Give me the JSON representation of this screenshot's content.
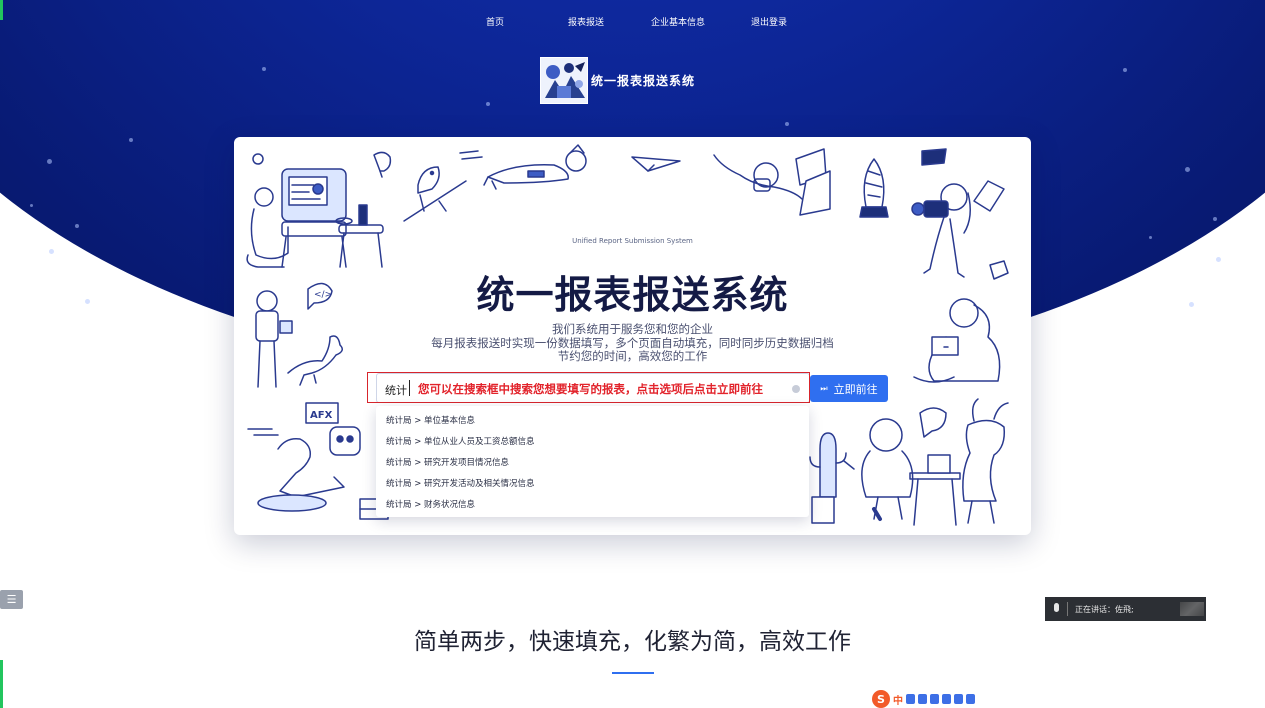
{
  "nav": {
    "items": [
      {
        "label": "首页"
      },
      {
        "label": "报表报送"
      },
      {
        "label": "企业基本信息"
      },
      {
        "label": "退出登录"
      }
    ]
  },
  "logo": {
    "text": "统一报表报送系统"
  },
  "hero": {
    "subtitle_en": "Unified Report Submission System",
    "title": "统一报表报送系统",
    "desc_lines": [
      "我们系统用于服务您和您的企业",
      "每月报表报送时实现一份数据填写，多个页面自动填充，同时同步历史数据归档",
      "节约您的时间，高效您的工作"
    ]
  },
  "search": {
    "value": "统计",
    "hint": "您可以在搜索框中搜索您想要填写的报表，点击选项后点击立即前往",
    "button_label": "立即前往",
    "button_icon": "fast-forward-icon",
    "results": [
      "统计局 > 单位基本信息",
      "统计局 > 单位从业人员及工资总额信息",
      "统计局 > 研究开发项目情况信息",
      "统计局 > 研究开发活动及相关情况信息",
      "统计局 > 财务状况信息"
    ]
  },
  "section": {
    "title": "简单两步，快速填充，化繁为简，高效工作"
  },
  "voice": {
    "text": "正在讲话：佐飛;"
  },
  "ime": {
    "lang": "中",
    "logo": "S"
  },
  "colors": {
    "hero_bg": "#0d2697",
    "accent": "#2f6ff0",
    "hint_red": "#e2232b",
    "title_dark": "#141a45"
  }
}
